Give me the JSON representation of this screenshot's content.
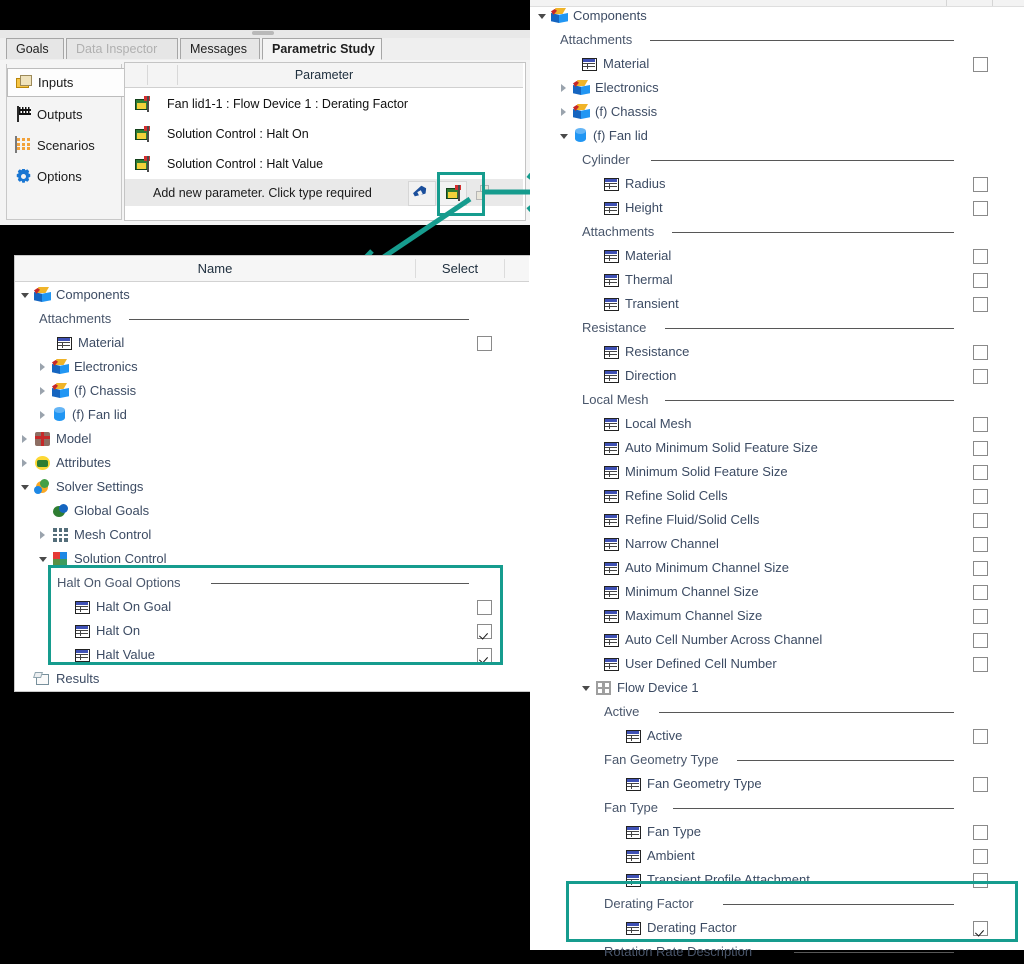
{
  "window": {
    "tabs": [
      {
        "label": "Goals",
        "state": "normal"
      },
      {
        "label": "Data Inspector",
        "state": "disabled"
      },
      {
        "label": "Messages",
        "state": "normal"
      },
      {
        "label": "Parametric Study",
        "state": "active"
      }
    ]
  },
  "parametric_study": {
    "sidebar": [
      {
        "label": "Inputs",
        "icon": "folder-inputs-icon",
        "selected": true
      },
      {
        "label": "Outputs",
        "icon": "checkered-flag-icon",
        "selected": false
      },
      {
        "label": "Scenarios",
        "icon": "grid-scenarios-icon",
        "selected": false
      },
      {
        "label": "Options",
        "icon": "gear-icon",
        "selected": false
      }
    ],
    "table": {
      "header": "Parameter",
      "rows": [
        "Fan lid1-1 : Flow Device 1 : Derating Factor",
        "Solution Control : Halt On",
        "Solution Control : Halt Value"
      ],
      "add_row_text": "Add new parameter. Click type required",
      "add_row_buttons": [
        {
          "icon": "pencil-edit-icon",
          "name": "edit-parameter-button"
        },
        {
          "icon": "flag-parameter-icon",
          "name": "add-parameter-flag-button"
        },
        {
          "icon": "copy-icon",
          "name": "copy-parameter-button"
        }
      ]
    }
  },
  "left_tree": {
    "columns": {
      "name": "Name",
      "select": "Select"
    },
    "rows": [
      {
        "label": "Components",
        "indent": 0,
        "icon": "component-cube-icon",
        "twisty": "open",
        "type": "node"
      },
      {
        "label": "Attachments",
        "indent": 1,
        "type": "group"
      },
      {
        "label": "Material",
        "indent": 2,
        "icon": "parameter-grid-icon",
        "type": "leaf",
        "checked": false
      },
      {
        "label": "Electronics",
        "indent": 1,
        "icon": "component-cube-icon",
        "twisty": "closed",
        "type": "node"
      },
      {
        "label": "(f) Chassis",
        "indent": 1,
        "icon": "component-cube-icon",
        "twisty": "closed",
        "type": "node"
      },
      {
        "label": "(f) Fan lid",
        "indent": 1,
        "icon": "cylinder-icon",
        "twisty": "closed",
        "type": "node"
      },
      {
        "label": "Model",
        "indent": 0,
        "icon": "model-icon",
        "twisty": "closed",
        "type": "node"
      },
      {
        "label": "Attributes",
        "indent": 0,
        "icon": "attributes-icon",
        "twisty": "closed",
        "type": "node"
      },
      {
        "label": "Solver Settings",
        "indent": 0,
        "icon": "solver-settings-icon",
        "twisty": "open",
        "type": "node"
      },
      {
        "label": "Global Goals",
        "indent": 1,
        "icon": "global-goals-icon",
        "type": "node"
      },
      {
        "label": "Mesh Control",
        "indent": 1,
        "icon": "mesh-control-icon",
        "twisty": "closed",
        "type": "node"
      },
      {
        "label": "Solution Control",
        "indent": 1,
        "icon": "solution-control-icon",
        "twisty": "open",
        "type": "node"
      },
      {
        "label": "Halt On Goal Options",
        "indent": 2,
        "type": "group"
      },
      {
        "label": "Halt On Goal",
        "indent": 3,
        "icon": "parameter-grid-icon",
        "type": "leaf",
        "checked": false
      },
      {
        "label": "Halt On",
        "indent": 3,
        "icon": "parameter-grid-icon",
        "type": "leaf",
        "checked": true
      },
      {
        "label": "Halt Value",
        "indent": 3,
        "icon": "parameter-grid-icon",
        "type": "leaf",
        "checked": true
      },
      {
        "label": "Results",
        "indent": 0,
        "icon": "results-icon",
        "type": "node"
      }
    ]
  },
  "right_tree": {
    "rows": [
      {
        "label": "Components",
        "indent": 0,
        "icon": "component-cube-icon",
        "twisty": "open",
        "type": "node"
      },
      {
        "label": "Attachments",
        "indent": 1,
        "type": "group"
      },
      {
        "label": "Material",
        "indent": 2,
        "icon": "parameter-grid-icon",
        "type": "leaf",
        "checked": false
      },
      {
        "label": "Electronics",
        "indent": 1,
        "icon": "component-cube-icon",
        "twisty": "closed",
        "type": "node"
      },
      {
        "label": "(f) Chassis",
        "indent": 1,
        "icon": "component-cube-icon",
        "twisty": "closed",
        "type": "node"
      },
      {
        "label": "(f) Fan lid",
        "indent": 1,
        "icon": "cylinder-icon",
        "twisty": "open",
        "type": "node"
      },
      {
        "label": "Cylinder",
        "indent": 2,
        "type": "group"
      },
      {
        "label": "Radius",
        "indent": 3,
        "icon": "parameter-grid-icon",
        "type": "leaf",
        "checked": false
      },
      {
        "label": "Height",
        "indent": 3,
        "icon": "parameter-grid-icon",
        "type": "leaf",
        "checked": false
      },
      {
        "label": "Attachments",
        "indent": 2,
        "type": "group"
      },
      {
        "label": "Material",
        "indent": 3,
        "icon": "parameter-grid-icon",
        "type": "leaf",
        "checked": false
      },
      {
        "label": "Thermal",
        "indent": 3,
        "icon": "parameter-grid-icon",
        "type": "leaf",
        "checked": false
      },
      {
        "label": "Transient",
        "indent": 3,
        "icon": "parameter-grid-icon",
        "type": "leaf",
        "checked": false
      },
      {
        "label": "Resistance",
        "indent": 2,
        "type": "group"
      },
      {
        "label": "Resistance",
        "indent": 3,
        "icon": "parameter-grid-icon",
        "type": "leaf",
        "checked": false
      },
      {
        "label": "Direction",
        "indent": 3,
        "icon": "parameter-grid-icon",
        "type": "leaf",
        "checked": false
      },
      {
        "label": "Local Mesh",
        "indent": 2,
        "type": "group"
      },
      {
        "label": "Local Mesh",
        "indent": 3,
        "icon": "parameter-grid-icon",
        "type": "leaf",
        "checked": false
      },
      {
        "label": "Auto Minimum Solid Feature Size",
        "indent": 3,
        "icon": "parameter-grid-icon",
        "type": "leaf",
        "checked": false
      },
      {
        "label": "Minimum Solid Feature Size",
        "indent": 3,
        "icon": "parameter-grid-icon",
        "type": "leaf",
        "checked": false
      },
      {
        "label": "Refine Solid Cells",
        "indent": 3,
        "icon": "parameter-grid-icon",
        "type": "leaf",
        "checked": false
      },
      {
        "label": "Refine Fluid/Solid Cells",
        "indent": 3,
        "icon": "parameter-grid-icon",
        "type": "leaf",
        "checked": false
      },
      {
        "label": "Narrow Channel",
        "indent": 3,
        "icon": "parameter-grid-icon",
        "type": "leaf",
        "checked": false
      },
      {
        "label": "Auto Minimum Channel Size",
        "indent": 3,
        "icon": "parameter-grid-icon",
        "type": "leaf",
        "checked": false
      },
      {
        "label": "Minimum Channel Size",
        "indent": 3,
        "icon": "parameter-grid-icon",
        "type": "leaf",
        "checked": false
      },
      {
        "label": "Maximum Channel Size",
        "indent": 3,
        "icon": "parameter-grid-icon",
        "type": "leaf",
        "checked": false
      },
      {
        "label": "Auto Cell Number Across Channel",
        "indent": 3,
        "icon": "parameter-grid-icon",
        "type": "leaf",
        "checked": false
      },
      {
        "label": "User Defined Cell Number",
        "indent": 3,
        "icon": "parameter-grid-icon",
        "type": "leaf",
        "checked": false
      },
      {
        "label": "Flow Device 1",
        "indent": 2,
        "icon": "fan-device-icon",
        "twisty": "open",
        "type": "node"
      },
      {
        "label": "Active",
        "indent": 3,
        "type": "group"
      },
      {
        "label": "Active",
        "indent": 4,
        "icon": "parameter-grid-icon",
        "type": "leaf",
        "checked": false
      },
      {
        "label": "Fan Geometry Type",
        "indent": 3,
        "type": "group"
      },
      {
        "label": "Fan Geometry Type",
        "indent": 4,
        "icon": "parameter-grid-icon",
        "type": "leaf",
        "checked": false
      },
      {
        "label": "Fan Type",
        "indent": 3,
        "type": "group"
      },
      {
        "label": "Fan Type",
        "indent": 4,
        "icon": "parameter-grid-icon",
        "type": "leaf",
        "checked": false
      },
      {
        "label": "Ambient",
        "indent": 4,
        "icon": "parameter-grid-icon",
        "type": "leaf",
        "checked": false
      },
      {
        "label": "Transient Profile Attachment",
        "indent": 4,
        "icon": "parameter-grid-icon",
        "type": "leaf",
        "checked": false
      },
      {
        "label": "Derating Factor",
        "indent": 3,
        "type": "group"
      },
      {
        "label": "Derating Factor",
        "indent": 4,
        "icon": "parameter-grid-icon",
        "type": "leaf",
        "checked": true
      },
      {
        "label": "Rotation Rate Description",
        "indent": 3,
        "type": "group"
      }
    ]
  },
  "annotations": {
    "accent_color": "#169c8e",
    "highlights": [
      {
        "name": "add-parameter-button-highlight"
      },
      {
        "name": "halt-on-goal-options-highlight"
      },
      {
        "name": "derating-factor-highlight"
      }
    ],
    "arrows": [
      {
        "name": "arrow-to-right-tree"
      },
      {
        "name": "arrow-to-left-tree"
      }
    ]
  }
}
